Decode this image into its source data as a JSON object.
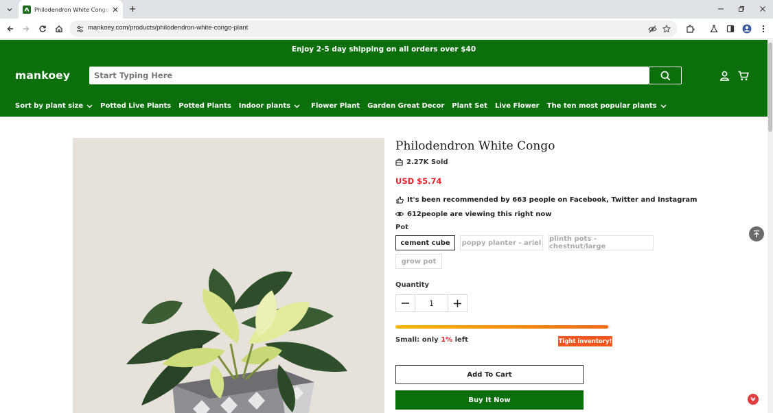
{
  "browser": {
    "tab_title": "Philodendron White Congo - mankoey",
    "url": "mankoey.com/products/philodendron-white-congo-plant",
    "icons": [
      "tab-search-icon",
      "close-icon",
      "plus-icon",
      "minimize-icon",
      "restore-icon",
      "back-icon",
      "forward-icon",
      "reload-icon",
      "home-icon",
      "site-settings-icon",
      "eye-off-icon",
      "star-icon",
      "extensions-icon",
      "labs-icon",
      "sidebar-icon",
      "profile-icon",
      "menu-icon"
    ]
  },
  "header": {
    "promo": "Enjoy 2-5 day shipping on all orders over $40",
    "logo": "mankoey",
    "search_placeholder": "Start Typing Here",
    "nav": [
      {
        "label": "Sort by plant size",
        "dropdown": true
      },
      {
        "label": "Potted Live Plants",
        "dropdown": false
      },
      {
        "label": "Potted Plants",
        "dropdown": false
      },
      {
        "label": "Indoor plants",
        "dropdown": true
      },
      {
        "label": "Flower Plant",
        "dropdown": false
      },
      {
        "label": "Garden Great Decor",
        "dropdown": false
      },
      {
        "label": "Plant Set",
        "dropdown": false
      },
      {
        "label": "Live Flower",
        "dropdown": false
      },
      {
        "label": "The ten most popular plants",
        "dropdown": true
      }
    ],
    "brand_color": "#0b6f0b"
  },
  "product": {
    "title": "Philodendron White Congo",
    "sold": "2.27K Sold",
    "price": "USD $5.74",
    "recommended": "It's been recommended by 663 people on Facebook, Twitter and Instagram",
    "viewing": "612people are viewing this right now",
    "pot_label": "Pot",
    "pot_options": [
      "cement cube",
      "poppy planter - ariel",
      "plinth pots - chestnut/large",
      "grow pot"
    ],
    "pot_selected": "cement cube",
    "quantity_label": "Quantity",
    "quantity": "1",
    "stock_prefix": "Small: only ",
    "stock_percent": "1%",
    "stock_suffix": " left",
    "stock_fill_fraction": 0.99,
    "tight_badge": "Tight inventory!",
    "add_to_cart": "Add To Cart",
    "buy_now": "Buy It Now",
    "price_color": "#e3262e"
  }
}
